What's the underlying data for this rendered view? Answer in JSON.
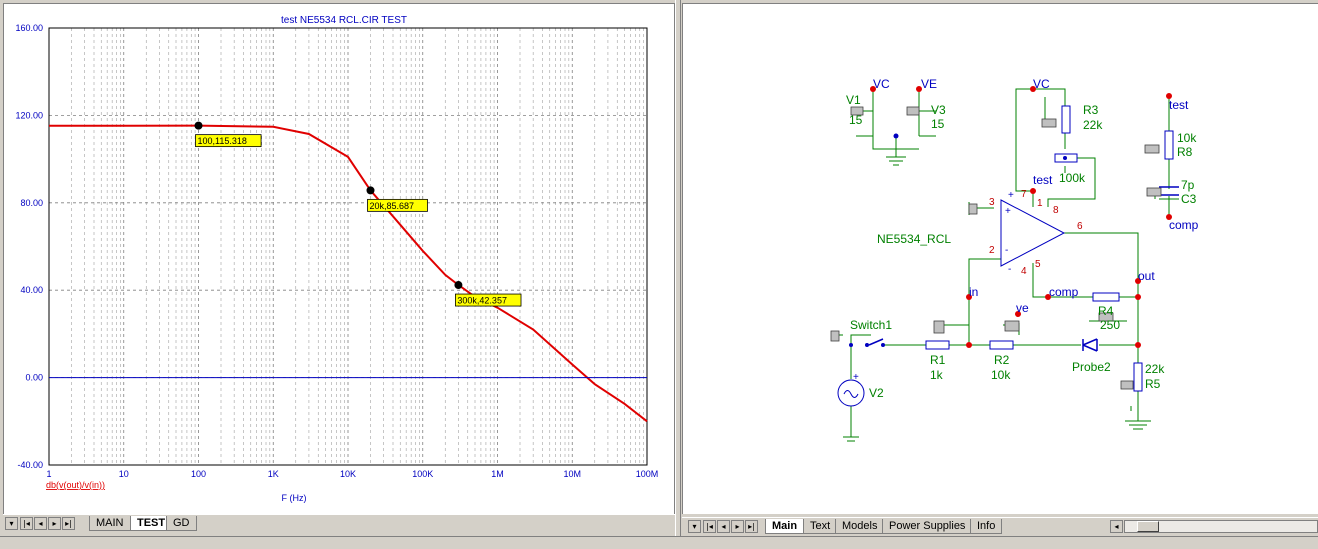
{
  "chart": {
    "title": "test NE5534 RCL.CIR TEST",
    "xlabel": "F (Hz)",
    "trace_label": "db(v(out)/v(in))"
  },
  "chart_data": {
    "type": "line",
    "title": "test NE5534 RCL.CIR TEST",
    "xlabel": "F (Hz)",
    "ylabel": "",
    "x_scale": "log",
    "xlim": [
      1,
      100000000
    ],
    "ylim": [
      -40,
      160
    ],
    "x_tick_labels": [
      "1",
      "10",
      "100",
      "1K",
      "10K",
      "100K",
      "1M",
      "10M",
      "100M"
    ],
    "y_tick_labels": [
      "160.00",
      "120.00",
      "80.00",
      "40.00",
      "0.00",
      "-40.00"
    ],
    "y_tick_values": [
      160,
      120,
      80,
      40,
      0,
      -40
    ],
    "grid": true,
    "series": [
      {
        "name": "db(v(out)/v(in))",
        "color": "#e00000",
        "x": [
          1,
          10,
          100,
          1000,
          3000,
          10000,
          20000,
          50000,
          100000,
          200000,
          300000,
          500000,
          1000000,
          3000000,
          10000000,
          20000000,
          50000000,
          100000000
        ],
        "y": [
          115.3,
          115.3,
          115.318,
          114.8,
          111.5,
          101,
          85.687,
          70,
          58,
          47,
          42.357,
          37,
          32,
          22,
          6,
          -3,
          -12,
          -20
        ]
      },
      {
        "name": "",
        "color": "#0000c0",
        "x": [
          1,
          100000000
        ],
        "y": [
          0,
          0
        ]
      }
    ],
    "annotations": [
      {
        "x": 100,
        "y": 115.318,
        "label": "100,115.318"
      },
      {
        "x": 20000,
        "y": 85.687,
        "label": "20k,85.687"
      },
      {
        "x": 300000,
        "y": 42.357,
        "label": "300k,42.357"
      }
    ]
  },
  "left_tabs": [
    "MAIN",
    "TEST",
    "GD"
  ],
  "left_active_tab": "TEST",
  "right_tabs": [
    "Main",
    "Text",
    "Models",
    "Power Supplies",
    "Info"
  ],
  "right_active_tab": "Main",
  "nav_icons": [
    "first-icon",
    "prev-icon",
    "next-icon",
    "last-icon"
  ],
  "nav_glyphs": {
    "down": "▾",
    "first": "|◂",
    "prev": "◂",
    "next": "▸",
    "last": "▸|",
    "left": "◂"
  },
  "schematic": {
    "v1_name": "V1",
    "v1_value": "15",
    "v3_name": "V3",
    "v3_value": "15",
    "vc_top": "VC",
    "ve_top": "VE",
    "vc_r3": "VC",
    "r3_name": "R3",
    "r3_value": "22k",
    "pot_value": "100k",
    "test_label": "test",
    "opamp_name": "NE5534_RCL",
    "pin3": "3",
    "pin2": "2",
    "pin7": "7",
    "pin4": "4",
    "pin1": "1",
    "pin8": "8",
    "pin6": "6",
    "pin5": "5",
    "plus": "+",
    "minus": "-",
    "test_node": "test",
    "r8_value": "10k",
    "r8_name": "R8",
    "c3_value": "7p",
    "c3_name": "C3",
    "comp_node": "comp",
    "out_node": "out",
    "comp_label": "comp",
    "in_node": "in",
    "ve_node": "ve",
    "r4_name": "R4",
    "r4_value": "250",
    "switch_name": "Switch1",
    "r1_name": "R1",
    "r1_value": "1k",
    "r2_name": "R2",
    "r2_value": "10k",
    "probe_name": "Probe2",
    "r5_value": "22k",
    "r5_name": "R5",
    "v2_name": "V2"
  },
  "colors": {
    "wire": "#008000",
    "label": "#0000c0",
    "node": "#e00000",
    "pin": "#c00000",
    "value": "#008000"
  }
}
